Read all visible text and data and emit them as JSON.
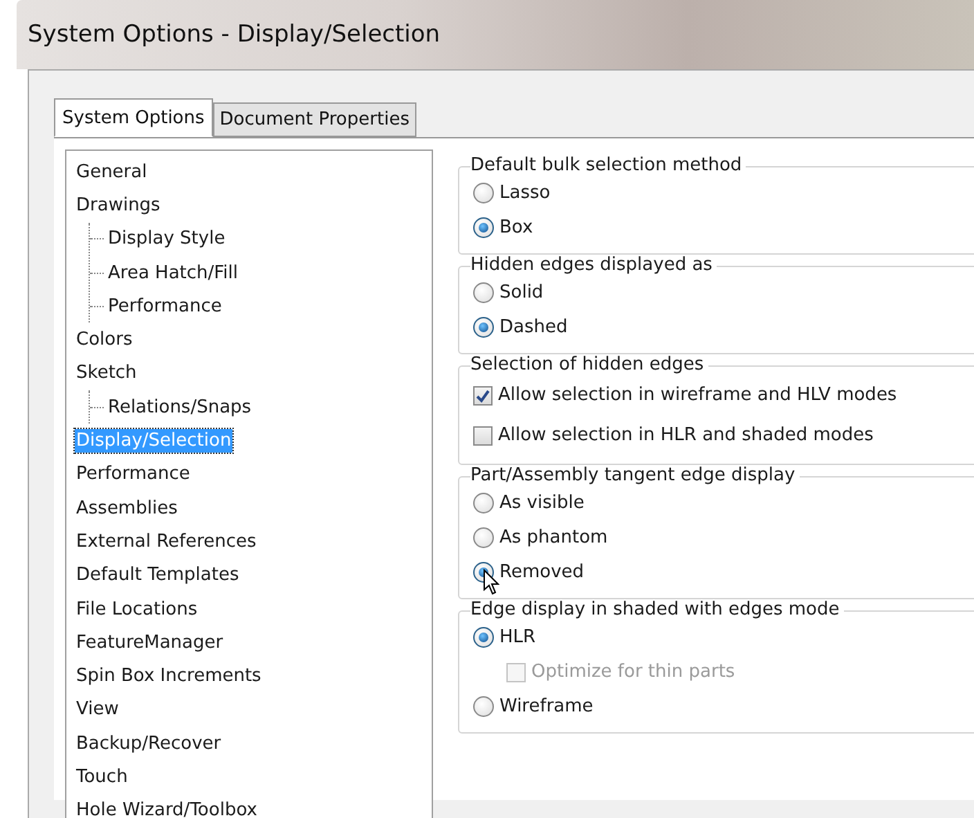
{
  "window": {
    "title": "System Options - Display/Selection"
  },
  "tabs": [
    {
      "label": "System Options",
      "selected": true
    },
    {
      "label": "Document Properties",
      "selected": false
    }
  ],
  "tree": [
    {
      "label": "General",
      "selected": false
    },
    {
      "label": "Drawings",
      "selected": false,
      "children": [
        {
          "label": "Display Style",
          "selected": false
        },
        {
          "label": "Area Hatch/Fill",
          "selected": false
        },
        {
          "label": "Performance",
          "selected": false
        }
      ]
    },
    {
      "label": "Colors",
      "selected": false
    },
    {
      "label": "Sketch",
      "selected": false,
      "children": [
        {
          "label": "Relations/Snaps",
          "selected": false
        }
      ]
    },
    {
      "label": "Display/Selection",
      "selected": true
    },
    {
      "label": "Performance",
      "selected": false
    },
    {
      "label": "Assemblies",
      "selected": false
    },
    {
      "label": "External References",
      "selected": false
    },
    {
      "label": "Default Templates",
      "selected": false
    },
    {
      "label": "File Locations",
      "selected": false
    },
    {
      "label": "FeatureManager",
      "selected": false
    },
    {
      "label": "Spin Box Increments",
      "selected": false
    },
    {
      "label": "View",
      "selected": false
    },
    {
      "label": "Backup/Recover",
      "selected": false
    },
    {
      "label": "Touch",
      "selected": false
    },
    {
      "label": "Hole Wizard/Toolbox",
      "selected": false
    }
  ],
  "groups": [
    {
      "legend": "Default bulk selection method",
      "options": [
        {
          "kind": "radio",
          "label": "Lasso",
          "selected": false
        },
        {
          "kind": "radio",
          "label": "Box",
          "selected": true
        }
      ]
    },
    {
      "legend": "Hidden edges displayed as",
      "options": [
        {
          "kind": "radio",
          "label": "Solid",
          "selected": false
        },
        {
          "kind": "radio",
          "label": "Dashed",
          "selected": true
        }
      ]
    },
    {
      "legend": "Selection of hidden edges",
      "options": [
        {
          "kind": "checkbox",
          "label": "Allow selection in wireframe and HLV modes",
          "checked": true
        },
        {
          "kind": "checkbox",
          "label": "Allow selection in HLR and shaded modes",
          "checked": false
        }
      ]
    },
    {
      "legend": "Part/Assembly tangent edge display",
      "options": [
        {
          "kind": "radio",
          "label": "As visible",
          "selected": false
        },
        {
          "kind": "radio",
          "label": "As phantom",
          "selected": false
        },
        {
          "kind": "radio",
          "label": "Removed",
          "selected": true
        }
      ]
    },
    {
      "legend": "Edge display in shaded with edges mode",
      "options": [
        {
          "kind": "radio",
          "label": "HLR",
          "selected": true,
          "children": [
            {
              "kind": "checkbox",
              "label": "Optimize for thin parts",
              "checked": false,
              "disabled": true
            }
          ]
        },
        {
          "kind": "radio",
          "label": "Wireframe",
          "selected": false
        }
      ]
    }
  ]
}
